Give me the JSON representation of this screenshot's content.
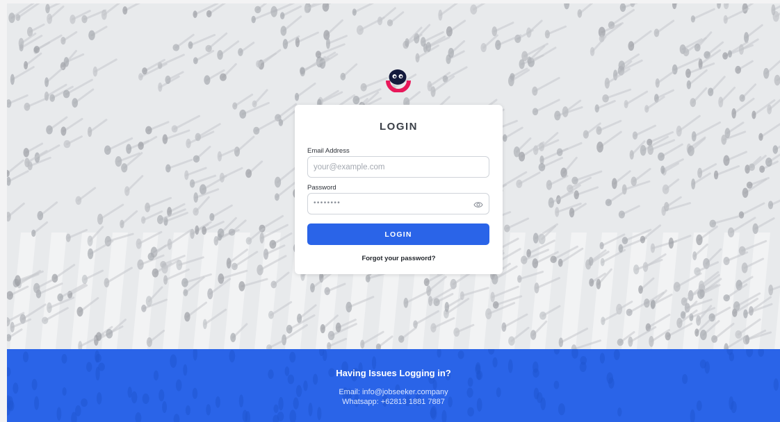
{
  "login_card": {
    "title": "LOGIN",
    "email_label": "Email Address",
    "email_placeholder": "your@example.com",
    "email_value": "",
    "password_label": "Password",
    "password_mask": "••••••••",
    "password_toggle_icon": "eye-icon",
    "submit_label": "LOGIN",
    "forgot_link": "Forgot your password?"
  },
  "logo": {
    "icon": "jobseeker-logo-icon",
    "colors": {
      "navy": "#141a3c",
      "pink": "#e8185a"
    }
  },
  "footer": {
    "title": "Having Issues Logging in?",
    "email_line": "Email: info@jobseeker.company",
    "whatsapp_line": "Whatsapp: +62813 1881 7887"
  },
  "theme": {
    "accent": "#2a64e8",
    "background": "#e6e7ea",
    "card": "#ffffff"
  }
}
